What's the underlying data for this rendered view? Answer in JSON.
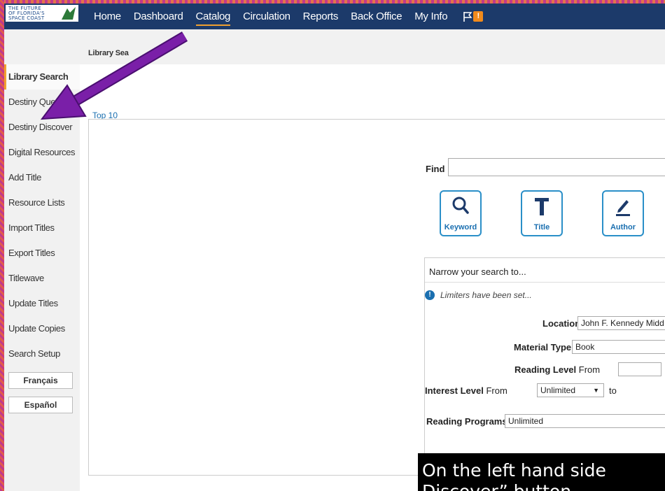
{
  "logo": {
    "lines": [
      "THE FUTURE",
      "OF FLORIDA'S",
      "SPACE COAST"
    ]
  },
  "nav": {
    "items": [
      {
        "label": "Home",
        "active": false
      },
      {
        "label": "Dashboard",
        "active": false
      },
      {
        "label": "Catalog",
        "active": true
      },
      {
        "label": "Circulation",
        "active": false
      },
      {
        "label": "Reports",
        "active": false
      },
      {
        "label": "Back Office",
        "active": false
      },
      {
        "label": "My Info",
        "active": false
      }
    ],
    "flag_badge": "!"
  },
  "breadcrumb": "Library Sea",
  "sidebar": {
    "items": [
      "Library Search",
      "Destiny Que",
      "Destiny Discover",
      "Digital Resources",
      "Add Title",
      "Resource Lists",
      "Import Titles",
      "Export Titles",
      "Titlewave",
      "Update Titles",
      "Update Copies",
      "Search Setup"
    ],
    "active_index": 0,
    "languages": [
      "Français",
      "Español"
    ]
  },
  "main": {
    "top10_link": "Top 10",
    "find_label": "Find",
    "find_value": "",
    "search_buttons": [
      {
        "label": "Keyword",
        "icon": "magnifier-icon"
      },
      {
        "label": "Title",
        "icon": "title-t-icon"
      },
      {
        "label": "Author",
        "icon": "pen-icon"
      }
    ],
    "narrow": {
      "title": "Narrow your search to...",
      "limiter_notice": "Limiters have been set...",
      "location_label": "Location",
      "location_value": "John F. Kennedy Midd",
      "material_label": "Material Type",
      "material_value": "Book",
      "reading_level_label": "Reading Level",
      "reading_from_label": "From",
      "reading_from_value": "",
      "interest_level_label": "Interest Level",
      "interest_from_label": "From",
      "interest_from_value": "Unlimited",
      "interest_to_label": "to",
      "reading_programs_label": "Reading Programs",
      "reading_programs_value": "Unlimited"
    }
  },
  "caption": {
    "line1": "On the left hand side",
    "line2": "Discover” button"
  },
  "colors": {
    "nav_bg": "#1c3a6a",
    "accent_orange": "#f0a030",
    "link_blue": "#1a6fb0",
    "button_border": "#2a8fc8",
    "arrow_purple": "#7a1fa8"
  }
}
